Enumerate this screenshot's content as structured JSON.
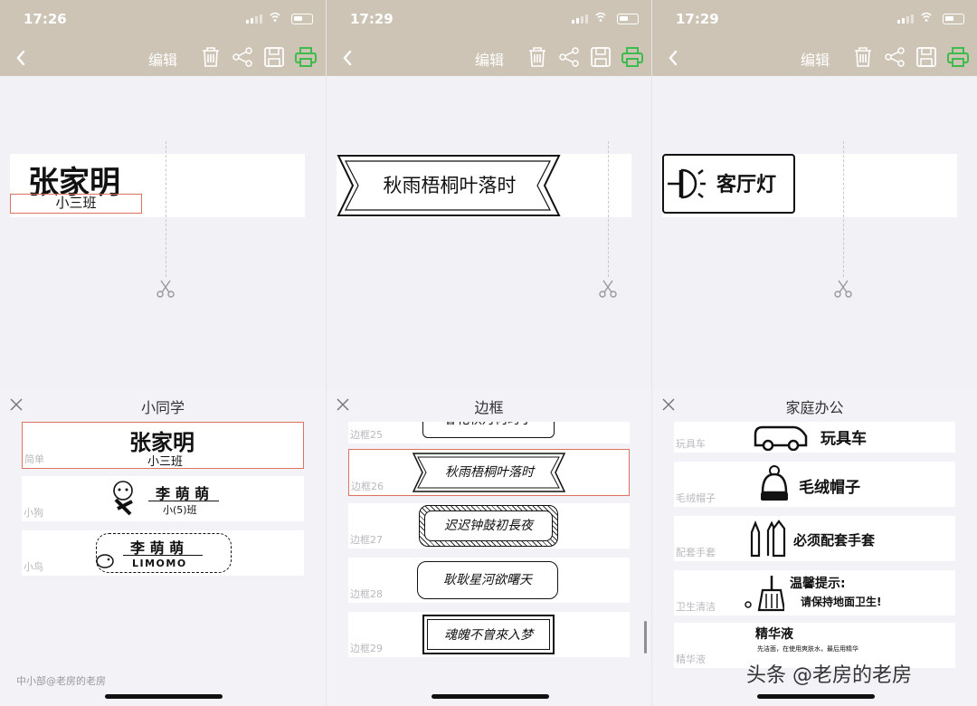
{
  "panels": [
    {
      "time": "17:26",
      "edit": "编辑",
      "label_main": "张家明",
      "label_sub": "小三班",
      "sheet_title": "小同学",
      "items": [
        {
          "tag": "简单",
          "line1": "张家明",
          "line2": "小三班"
        },
        {
          "tag": "小狗",
          "line1": "李 萌 萌",
          "line2": "小(5)班"
        },
        {
          "tag": "小鸟",
          "line1": "李 萌 萌",
          "line2": "LIMOMO"
        }
      ]
    },
    {
      "time": "17:29",
      "edit": "编辑",
      "label_main": "秋雨梧桐叶落时",
      "sheet_title": "边框",
      "items": [
        {
          "tag": "边框25",
          "text": "春花秋月何时了"
        },
        {
          "tag": "边框26",
          "text": "秋雨梧桐叶落时"
        },
        {
          "tag": "边框27",
          "text": "迟迟钟鼓初長夜"
        },
        {
          "tag": "边框28",
          "text": "耿耿星河欲曙天"
        },
        {
          "tag": "边框29",
          "text": "魂魄不曾來入梦"
        }
      ]
    },
    {
      "time": "17:29",
      "edit": "编辑",
      "label_main": "客厅灯",
      "sheet_title": "家庭办公",
      "items": [
        {
          "tag": "玩具车",
          "text": "玩具车"
        },
        {
          "tag": "毛绒帽子",
          "text": "毛绒帽子"
        },
        {
          "tag": "配套手套",
          "text": "必须配套手套"
        },
        {
          "tag": "卫生清洁",
          "text": "温馨提示:",
          "text2": "请保持地面卫生!"
        },
        {
          "tag": "精华液",
          "text": "精华液",
          "text2": "先洁面，在使用爽肤水，最后用精华"
        }
      ]
    }
  ],
  "watermark_left": "中小部@老房的老房",
  "watermark_right": "头条 @老房的老房"
}
